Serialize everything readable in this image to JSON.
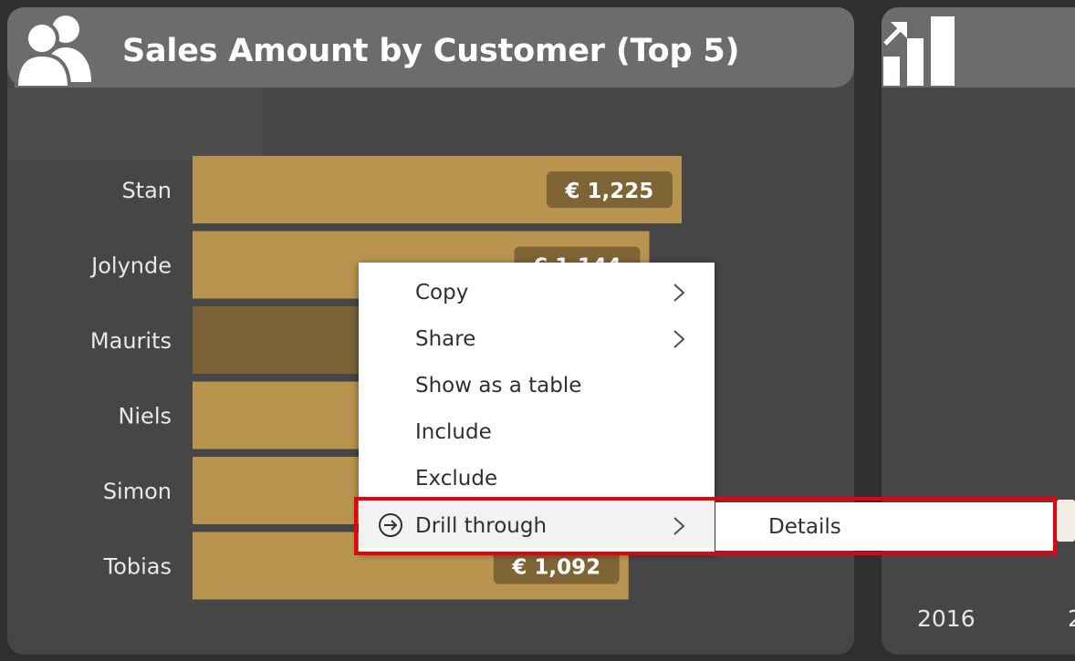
{
  "visual": {
    "title": "Sales Amount by Customer (Top 5)",
    "icon": "users-icon"
  },
  "side_visual": {
    "icon": "bar-chart-icon",
    "axis_year": "2016",
    "axis_next_partial": "2"
  },
  "chart_data": {
    "type": "bar",
    "orientation": "horizontal",
    "title": "Sales Amount by Customer (Top 5)",
    "categories": [
      "Stan",
      "Jolynde",
      "Maurits",
      "Niels",
      "Simon",
      "Tobias"
    ],
    "values": [
      1225,
      1144,
      null,
      null,
      null,
      1092
    ],
    "data_labels": [
      "€ 1,225",
      "€ 1,144",
      "",
      "",
      "",
      "€ 1,092"
    ],
    "highlighted": "Maurits",
    "xlim": [
      0,
      1600
    ],
    "bar_color": "#b8944f",
    "highlight_bar_color": "#7a6136",
    "label_bg_color": "#7f6436"
  },
  "context_menu": {
    "items": [
      {
        "label": "Copy",
        "has_submenu": true
      },
      {
        "label": "Share",
        "has_submenu": true
      },
      {
        "label": "Show as a table",
        "has_submenu": false
      },
      {
        "label": "Include",
        "has_submenu": false
      },
      {
        "label": "Exclude",
        "has_submenu": false
      },
      {
        "label": "Drill through",
        "has_submenu": true,
        "icon": "drill-through-icon"
      }
    ],
    "submenu": {
      "parent": "Drill through",
      "items": [
        {
          "label": "Details"
        }
      ]
    }
  },
  "colors": {
    "background": "#2f2f2f",
    "panel": "#474646",
    "header": "#6d6b6b",
    "highlight_border": "#e8000b"
  }
}
